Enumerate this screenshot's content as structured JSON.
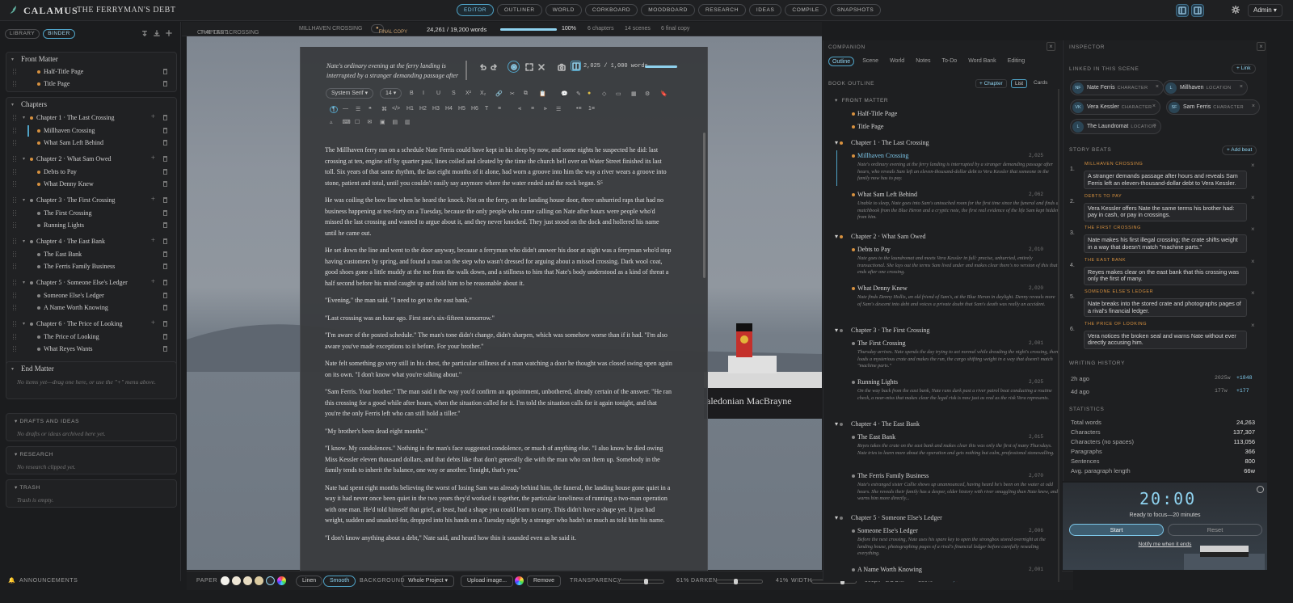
{
  "app": {
    "name": "CALAMUS",
    "doc_title": "THE FERRYMAN'S DEBT"
  },
  "modes": [
    "EDITOR",
    "OUTLINER",
    "WORLD",
    "CORKBOARD",
    "MOODBOARD",
    "RESEARCH",
    "IDEAS",
    "COMPILE",
    "SNAPSHOTS"
  ],
  "active_mode": "EDITOR",
  "user": "Admin",
  "left": {
    "tabs": [
      "LIBRARY",
      "BINDER"
    ],
    "front_matter": {
      "title": "Front Matter",
      "items": [
        "Half-Title Page",
        "Title Page"
      ]
    },
    "chapters_title": "Chapters",
    "chapters": [
      {
        "title": "Chapter 1 · The Last Crossing",
        "scenes": [
          "Millhaven Crossing",
          "What Sam Left Behind"
        ]
      },
      {
        "title": "Chapter 2 · What Sam Owed",
        "scenes": [
          "Debts to Pay",
          "What Denny Knew"
        ]
      },
      {
        "title": "Chapter 3 · The First Crossing",
        "scenes": [
          "The First Crossing",
          "Running Lights"
        ]
      },
      {
        "title": "Chapter 4 · The East Bank",
        "scenes": [
          "The East Bank",
          "The Ferris Family Business"
        ]
      },
      {
        "title": "Chapter 5 · Someone Else's Ledger",
        "scenes": [
          "Someone Else's Ledger",
          "A Name Worth Knowing"
        ]
      },
      {
        "title": "Chapter 6 · The Price of Looking",
        "scenes": [
          "The Price of Looking",
          "What Reyes Wants"
        ]
      }
    ],
    "end_matter": {
      "title": "End Matter",
      "hint": "No items yet—drag one here, or use the \"+\" menu above."
    },
    "drafts": {
      "title": "DRAFTS AND IDEAS",
      "hint": "No drafts or ideas archived here yet."
    },
    "research": {
      "title": "RESEARCH",
      "hint": "No research clipped yet."
    },
    "trash": {
      "title": "TRASH",
      "hint": "Trash is empty."
    },
    "announcements": "ANNOUNCEMENTS"
  },
  "strip": {
    "chapter": "CHAPTER 1",
    "chapter_name": "THE LAST CROSSING",
    "scene": "MILLHAVEN CROSSING",
    "status": "FINAL COPY",
    "words": "24,261 / 19,200 words",
    "pct": "100%",
    "chapters": "6 chapters",
    "scenes": "14 scenes",
    "final": "6 final copy",
    "progress": 1.0
  },
  "editor": {
    "preview": "Nate's ordinary evening at the ferry landing is interrupted by a stranger demanding passage after",
    "wc": "2,025 / 1,000 words",
    "wc_progress": 1.0,
    "font": "System Serif",
    "size": "14",
    "paragraphs": [
      "The Millhaven ferry ran on a schedule Nate Ferris could have kept in his sleep by now, and some nights he suspected he did: last crossing at ten, engine off by quarter past, lines coiled and cleated by the time the church bell over on Water Street finished its last toll. Six years of that same rhythm, the last eight months of it alone, had worn a groove into him the way a river wears a groove into stone, patient and total, until you couldn't easily say anymore where the water ended and the rock began. S⁵",
      "He was coiling the bow line when he heard the knock. Not on the ferry, on the landing house door, three unhurried raps that had no business happening at ten-forty on a Tuesday, because the only people who came calling on Nate after hours were people who'd missed the last crossing and wanted to argue about it, and they never knocked. They just stood on the dock and hollered his name until he came out.",
      "He set down the line and went to the door anyway, because a ferryman who didn't answer his door at night was a ferryman who'd stop having customers by spring, and found a man on the step who wasn't dressed for arguing about a missed crossing. Dark wool coat, good shoes gone a little muddy at the toe from the walk down, and a stillness to him that Nate's body understood as a kind of threat a half second before his mind caught up and told him to be reasonable about it.",
      "\"Evening,\" the man said. \"I need to get to the east bank.\"",
      "\"Last crossing was an hour ago. First one's six-fifteen tomorrow.\"",
      "\"I'm aware of the posted schedule.\" The man's tone didn't change, didn't sharpen, which was somehow worse than if it had. \"I'm also aware you've made exceptions to it before. For your brother.\"",
      "Nate felt something go very still in his chest, the particular stillness of a man watching a door he thought was closed swing open again on its own. \"I don't know what you're talking about.\"",
      "\"Sam Ferris. Your brother.\" The man said it the way you'd confirm an appointment, unbothered, already certain of the answer. \"He ran this crossing for a good while after hours, when the situation called for it. I'm told the situation calls for it again tonight, and that you're the only Ferris left who can still hold a tiller.\"",
      "\"My brother's been dead eight months.\"",
      "\"I know. My condolences.\" Nothing in the man's face suggested condolence, or much of anything else. \"I also know he died owing Miss Kessler eleven thousand dollars, and that debts like that don't generally die with the man who ran them up. Somebody in the family tends to inherit the balance, one way or another. Tonight, that's you.\"",
      "Nate had spent eight months believing the worst of losing Sam was already behind him, the funeral, the landing house gone quiet in a way it had never once been quiet in the two years they'd worked it together, the particular loneliness of running a two-man operation with one man. He'd told himself that grief, at least, had a shape you could learn to carry. This didn't have a shape yet. It just had weight, sudden and unasked-for, dropped into his hands on a Tuesday night by a stranger who hadn't so much as told him his name.",
      "\"I don't know anything about a debt,\" Nate said, and heard how thin it sounded even as he said it."
    ]
  },
  "bottombar": {
    "paper": "PAPER",
    "line": "Linen",
    "smooth": "Smooth",
    "background": "BACKGROUND",
    "scope": "Whole Project",
    "upload": "Upload image...",
    "remove": "Remove",
    "transparency": "TRANSPARENCY",
    "transparency_val": "61%",
    "transparency_level": 0.61,
    "darken": "DARKEN",
    "darken_val": "41%",
    "darken_level": 0.41,
    "width": "WIDTH",
    "width_val": "901px",
    "width_level": 0.7,
    "zoom": "ZOOM",
    "zoom_val": "100%"
  },
  "companion": {
    "title": "COMPANION",
    "tabs": [
      "Outline",
      "Scene",
      "World",
      "Notes",
      "To-Do",
      "Word Bank",
      "Editing"
    ],
    "outline_title": "BOOK OUTLINE",
    "add_chapter": "+ Chapter",
    "view_list": "List",
    "view_cards": "Cards",
    "front_matter": "FRONT MATTER",
    "front_items": [
      "Half-Title Page",
      "Title Page"
    ],
    "chapters": [
      {
        "title": "Chapter 1 · The Last Crossing",
        "scenes": [
          {
            "title": "Millhaven Crossing",
            "wc": "2,025",
            "syn": "Nate's ordinary evening at the ferry landing is interrupted by a stranger demanding passage after hours, who reveals Sam left an eleven-thousand-dollar debt to Vera Kessler that someone in the family now has to pay."
          },
          {
            "title": "What Sam Left Behind",
            "wc": "2,062",
            "syn": "Unable to sleep, Nate goes into Sam's untouched room for the first time since the funeral and finds a matchbook from the Blue Heron and a cryptic note, the first real evidence of the life Sam kept hidden from him."
          }
        ]
      },
      {
        "title": "Chapter 2 · What Sam Owed",
        "scenes": [
          {
            "title": "Debts to Pay",
            "wc": "2,010",
            "syn": "Nate goes to the laundromat and meets Vera Kessler in full: precise, unhurried, entirely transactional. She lays out the terms Sam lived under and makes clear there's no version of this that ends after one crossing."
          },
          {
            "title": "What Denny Knew",
            "wc": "2,020",
            "syn": "Nate finds Denny Hollis, an old friend of Sam's, at the Blue Heron in daylight. Denny reveals more of Sam's descent into debt and voices a private doubt that Sam's death was really an accident."
          }
        ]
      },
      {
        "title": "Chapter 3 · The First Crossing",
        "scenes": [
          {
            "title": "The First Crossing",
            "wc": "2,001",
            "syn": "Thursday arrives. Nate spends the day trying to act normal while dreading the night's crossing, then loads a mysterious crate and makes the run, the cargo shifting weight in a way that doesn't match \"machine parts.\""
          },
          {
            "title": "Running Lights",
            "wc": "2,025",
            "syn": "On the way back from the east bank, Nate runs dark past a river patrol boat conducting a routine check, a near-miss that makes clear the legal risk is now just as real as the risk Vera represents."
          }
        ]
      },
      {
        "title": "Chapter 4 · The East Bank",
        "scenes": [
          {
            "title": "The East Bank",
            "wc": "2,015",
            "syn": "Reyes takes the crate on the east bank and makes clear this was only the first of many Thursdays. Nate tries to learn more about the operation and gets nothing but calm, professional stonewalling."
          },
          {
            "title": "The Ferris Family Business",
            "wc": "2,070",
            "syn": "Nate's estranged sister Callie shows up unannounced, having heard he's been on the water at odd hours. She reveals their family has a deeper, older history with river smuggling than Nate knew, and warns him more directly..."
          }
        ]
      },
      {
        "title": "Chapter 5 · Someone Else's Ledger",
        "scenes": [
          {
            "title": "Someone Else's Ledger",
            "wc": "2,006",
            "syn": "Before the next crossing, Nate uses his spare key to open the strongbox stored overnight at the landing house, photographing pages of a rival's financial ledger before carefully resealing everything."
          },
          {
            "title": "A Name Worth Knowing",
            "wc": "2,001",
            "syn": ""
          }
        ]
      }
    ]
  },
  "inspector": {
    "title": "INSPECTOR",
    "linked_title": "LINKED IN THIS SCENE",
    "add_link": "+ Link",
    "links": [
      {
        "initials": "NF",
        "name": "Nate Ferris",
        "kind": "CHARACTER"
      },
      {
        "initials": "L",
        "name": "Millhaven",
        "kind": "LOCATION"
      },
      {
        "initials": "VK",
        "name": "Vera Kessler",
        "kind": "CHARACTER"
      },
      {
        "initials": "SF",
        "name": "Sam Ferris",
        "kind": "CHARACTER"
      },
      {
        "initials": "L",
        "name": "The Laundromat",
        "kind": "LOCATION"
      }
    ],
    "beats_title": "STORY BEATS",
    "add_beat": "+ Add beat",
    "beats": [
      {
        "n": "1.",
        "tag": "MILLHAVEN CROSSING",
        "text": "A stranger demands passage after hours and reveals Sam Ferris left an eleven-thousand-dollar debt to Vera Kessler."
      },
      {
        "n": "2.",
        "tag": "DEBTS TO PAY",
        "text": "Vera Kessler offers Nate the same terms his brother had: pay in cash, or pay in crossings."
      },
      {
        "n": "3.",
        "tag": "THE FIRST CROSSING",
        "text": "Nate makes his first illegal crossing; the crate shifts weight in a way that doesn't match \"machine parts.\""
      },
      {
        "n": "4.",
        "tag": "THE EAST BANK",
        "text": "Reyes makes clear on the east bank that this crossing was only the first of many."
      },
      {
        "n": "5.",
        "tag": "SOMEONE ELSE'S LEDGER",
        "text": "Nate breaks into the stored crate and photographs pages of a rival's financial ledger."
      },
      {
        "n": "6.",
        "tag": "THE PRICE OF LOOKING",
        "text": "Vera notices the broken seal and warns Nate without ever directly accusing him."
      }
    ],
    "history_title": "WRITING HISTORY",
    "history": [
      {
        "when": "2h ago",
        "words": "2025w",
        "delta": "+1848"
      },
      {
        "when": "4d ago",
        "words": "177w",
        "delta": "+177"
      }
    ],
    "stats_title": "STATISTICS",
    "stats": [
      {
        "k": "Total words",
        "v": "24,263"
      },
      {
        "k": "Characters",
        "v": "137,307"
      },
      {
        "k": "Characters (no spaces)",
        "v": "113,056"
      },
      {
        "k": "Paragraphs",
        "v": "366"
      },
      {
        "k": "Sentences",
        "v": "800"
      },
      {
        "k": "Avg. paragraph length",
        "v": "66w"
      }
    ]
  },
  "timer": {
    "time": "20:00",
    "caption": "Ready to focus—20 minutes",
    "start": "Start",
    "reset": "Reset",
    "notify": "Notify me when it ends"
  },
  "colors": {
    "accent": "#4fa3c7",
    "orange": "#d7913f",
    "bg": "#1b1c1e"
  },
  "icons": [
    "feather-icon",
    "sun-icon",
    "undo-icon",
    "redo-icon",
    "bold-icon",
    "italic-icon",
    "trash-icon",
    "close-icon",
    "camera-icon",
    "expand-icon"
  ]
}
